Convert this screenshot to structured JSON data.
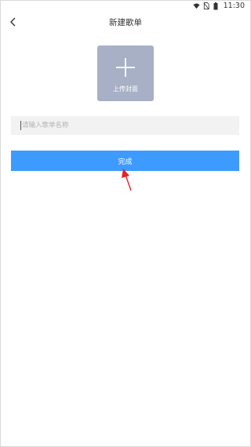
{
  "status_bar": {
    "time": "11:30",
    "icons": [
      "wifi-icon",
      "no-sim-icon",
      "battery-icon"
    ]
  },
  "header": {
    "title": "新建歌单",
    "back_icon": "chevron-left-icon"
  },
  "cover": {
    "label": "上传封面",
    "icon": "plus-icon"
  },
  "name_input": {
    "placeholder": "请输入歌单名称",
    "value": ""
  },
  "done_button": {
    "label": "完成"
  },
  "colors": {
    "accent": "#3d9bff",
    "cover_bg": "#a7b0c5",
    "input_bg": "#f2f2f2",
    "annotation": "#e8202a"
  }
}
